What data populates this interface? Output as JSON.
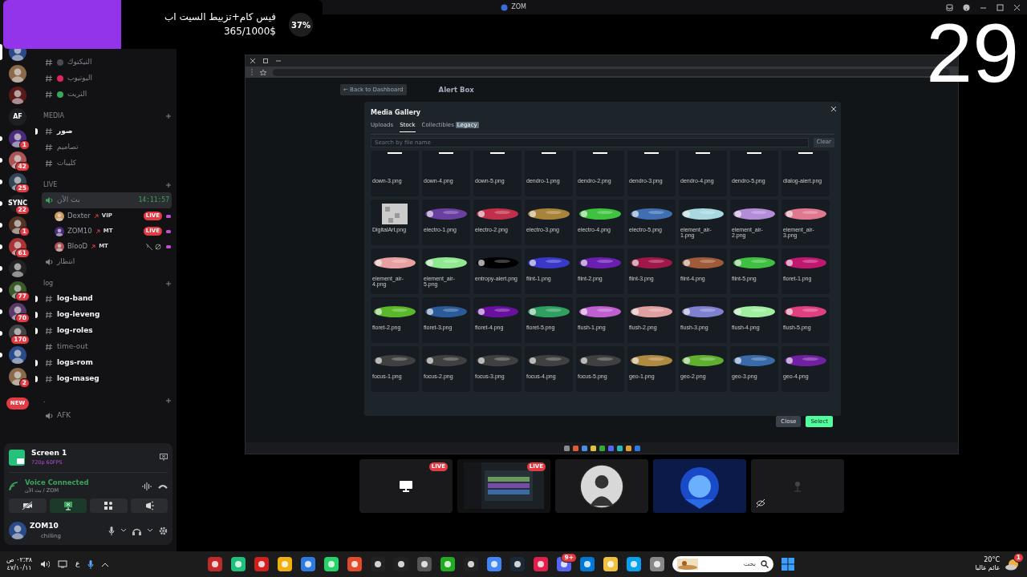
{
  "titlebar": {
    "title": "ZOM"
  },
  "goal": {
    "title": "فيس كام+تزبيط السيت اب",
    "amount": "365/1000$",
    "percent": "37%",
    "level": 0.37
  },
  "counter": "29",
  "servers": [
    {
      "kind": "avatar",
      "selected": true,
      "unread": false
    },
    {
      "kind": "avatar",
      "selected": false,
      "unread": false
    },
    {
      "kind": "avatar",
      "selected": false,
      "unread": false
    },
    {
      "kind": "text",
      "label": "AF",
      "selected": false,
      "unread": false
    },
    {
      "kind": "avatar",
      "badge": "1",
      "selected": false,
      "unread": true
    },
    {
      "kind": "avatar",
      "badge": "42",
      "selected": false,
      "unread": true
    },
    {
      "kind": "avatar",
      "badge": "25",
      "selected": false,
      "unread": true
    },
    {
      "kind": "text",
      "label": "SYNC",
      "badge": "22",
      "selected": false,
      "unread": true
    },
    {
      "kind": "avatar",
      "badge": "1",
      "selected": false,
      "unread": true
    },
    {
      "kind": "avatar",
      "badge": "61",
      "selected": false,
      "unread": true
    },
    {
      "kind": "avatar",
      "selected": false,
      "unread": true
    },
    {
      "kind": "avatar",
      "badge": "77",
      "selected": false,
      "unread": true
    },
    {
      "kind": "avatar",
      "badge": "70",
      "selected": false,
      "unread": true
    },
    {
      "kind": "avatar",
      "badge": "170",
      "selected": false,
      "unread": true
    },
    {
      "kind": "avatar",
      "selected": false,
      "unread": true
    },
    {
      "kind": "avatar",
      "badge": "2",
      "selected": false,
      "unread": false
    },
    {
      "kind": "new",
      "label": "NEW"
    }
  ],
  "channels": [
    {
      "kind": "text",
      "name": "التيكتوك",
      "color": "#4a4a52",
      "unread": false
    },
    {
      "kind": "text",
      "name": "اليوتيوب",
      "color": "#e0245e",
      "unread": false
    },
    {
      "kind": "text",
      "name": "الثريت",
      "color": "#3ba55c",
      "unread": false
    },
    {
      "kind": "category",
      "name": "MEDIA"
    },
    {
      "kind": "text",
      "name": "صور",
      "unread": true
    },
    {
      "kind": "text",
      "name": "تصاميم",
      "unread": false
    },
    {
      "kind": "text",
      "name": "كليبات",
      "unread": false
    },
    {
      "kind": "category",
      "name": "LIVE"
    },
    {
      "kind": "voice",
      "name": "بث الآن",
      "timer": "14:11:57",
      "selected": true,
      "members": [
        {
          "name": "Dexter",
          "role": "VIP",
          "badge": "LIVE",
          "muted": false
        },
        {
          "name": "ZOM10",
          "role": "MT",
          "badge": "LIVE",
          "muted": false
        },
        {
          "name": "BlooD",
          "role": "MT",
          "muted": true
        }
      ]
    },
    {
      "kind": "voice",
      "name": "انتظار",
      "selected": false
    },
    {
      "kind": "category",
      "name": "log"
    },
    {
      "kind": "text",
      "name": "log-band",
      "unread": true
    },
    {
      "kind": "text",
      "name": "log-leveng",
      "unread": true
    },
    {
      "kind": "text",
      "name": "log-roles",
      "unread": true
    },
    {
      "kind": "text",
      "name": "time-out",
      "unread": false
    },
    {
      "kind": "text",
      "name": "logs-rom",
      "unread": true
    },
    {
      "kind": "text",
      "name": "log-maseg",
      "unread": true
    },
    {
      "kind": "category",
      "name": "."
    },
    {
      "kind": "voice",
      "name": "AFK",
      "selected": false
    }
  ],
  "panel": {
    "screen": {
      "title": "Screen 1",
      "quality": "720p 60FPS"
    },
    "voice": {
      "status": "Voice Connected",
      "location": "بث الآن / ZOM"
    },
    "controls": [
      {
        "kind": "camera",
        "on": false
      },
      {
        "kind": "screen",
        "on": true
      },
      {
        "kind": "activities",
        "on": false
      },
      {
        "kind": "soundboard",
        "on": false
      }
    ],
    "user": {
      "name": "ZOM10",
      "status": "chilling"
    }
  },
  "browser": {
    "back_button": "← Back to Dashboard",
    "page_title": "Alert Box",
    "modal": {
      "title": "Media Gallery",
      "tabs": [
        {
          "label": "Uploads",
          "selected": false
        },
        {
          "label": "Stock",
          "selected": true
        },
        {
          "label": "Collectibles",
          "tag": "Legacy",
          "selected": false
        }
      ],
      "search": {
        "placeholder": "Search by file name"
      },
      "clear_button": "Clear",
      "files": [
        "down-3.png",
        "down-4.png",
        "down-5.png",
        "dendro-1.png",
        "dendro-2.png",
        "dendro-3.png",
        "dendro-4.png",
        "dendro-5.png",
        "dialog-alert.png",
        "DigitalArt.png",
        "electro-1.png",
        "electro-2.png",
        "electro-3.png",
        "electro-4.png",
        "electro-5.png",
        "element_air-1.png",
        "element_air-2.png",
        "element_air-3.png",
        "element_air-4.png",
        "element_air-5.png",
        "entropy-alert.png",
        "flint-1.png",
        "flint-2.png",
        "flint-3.png",
        "flint-4.png",
        "flint-5.png",
        "floret-1.png",
        "floret-2.png",
        "floret-3.png",
        "floret-4.png",
        "floret-5.png",
        "flush-1.png",
        "flush-2.png",
        "flush-3.png",
        "flush-4.png",
        "flush-5.png",
        "focus-1.png",
        "focus-2.png",
        "focus-3.png",
        "focus-4.png",
        "focus-5.png",
        "geo-1.png",
        "geo-2.png",
        "geo-3.png",
        "geo-4.png"
      ],
      "buttons": [
        {
          "kind": "secondary",
          "label": "Close"
        },
        {
          "kind": "primary",
          "label": "Select"
        }
      ]
    }
  },
  "stream_tiles": [
    {
      "kind": "screen",
      "badge": "LIVE"
    },
    {
      "kind": "preview",
      "badge": "LIVE"
    },
    {
      "kind": "avatar"
    },
    {
      "kind": "picture"
    },
    {
      "kind": "camera-off"
    }
  ],
  "taskbar": {
    "time": "٠٢:٣٨ ص",
    "date": "٤٧/١٠/١١",
    "language": "ع",
    "search": {
      "placeholder": "بحث"
    },
    "app_badge": "9+",
    "temperature": "20°C",
    "weather": "غائم غالبا",
    "notification_count": "1"
  }
}
